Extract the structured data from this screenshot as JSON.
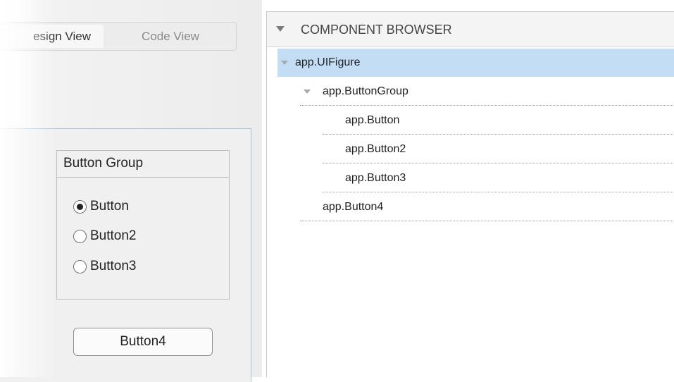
{
  "view_toggle": {
    "design_label": "Design View",
    "design_visible": "esign View",
    "code_label": "Code View"
  },
  "button_group": {
    "title": "Button Group",
    "options": [
      {
        "label": "Button",
        "checked": true
      },
      {
        "label": "Button2",
        "checked": false
      },
      {
        "label": "Button3",
        "checked": false
      }
    ]
  },
  "push_button": {
    "label": "Button4"
  },
  "component_browser": {
    "title": "COMPONENT BROWSER",
    "nodes": [
      {
        "label": "app.UIFigure",
        "selected": true,
        "expanded": true
      },
      {
        "label": "app.ButtonGroup",
        "expanded": true
      },
      {
        "label": "app.Button"
      },
      {
        "label": "app.Button2"
      },
      {
        "label": "app.Button3"
      },
      {
        "label": "app.Button4"
      }
    ]
  },
  "colors": {
    "selection": "#c2ddf4",
    "canvas_border": "#9fc7ea"
  }
}
